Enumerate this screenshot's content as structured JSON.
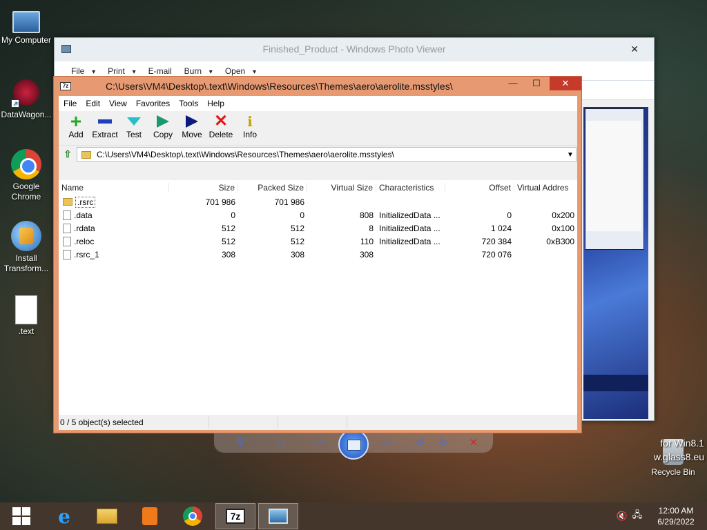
{
  "desktop": {
    "icons": [
      {
        "label": "My Computer"
      },
      {
        "label": "DataWagon..."
      },
      {
        "label": "Google Chrome"
      },
      {
        "label": "Install Transform..."
      },
      {
        "label": ".text"
      },
      {
        "label": "Recycle Bin"
      }
    ],
    "watermark_line1": "for Win8.1",
    "watermark_line2": "w.glass8.eu"
  },
  "photo_viewer": {
    "title": "Finished_Product - Windows Photo Viewer",
    "menu": [
      "File",
      "Print",
      "E-mail",
      "Burn",
      "Open"
    ],
    "help": "?"
  },
  "zip_window": {
    "title": "C:\\Users\\VM4\\Desktop\\.text\\Windows\\Resources\\Themes\\aero\\aerolite.msstyles\\",
    "icon_text": "7z",
    "menu": [
      "File",
      "Edit",
      "View",
      "Favorites",
      "Tools",
      "Help"
    ],
    "toolbar": [
      "Add",
      "Extract",
      "Test",
      "Copy",
      "Move",
      "Delete",
      "Info"
    ],
    "address": "C:\\Users\\VM4\\Desktop\\.text\\Windows\\Resources\\Themes\\aero\\aerolite.msstyles\\",
    "columns": [
      "Name",
      "Size",
      "Packed Size",
      "Virtual Size",
      "Characteristics",
      "Offset",
      "Virtual Addres"
    ],
    "rows": [
      {
        "name": ".rsrc",
        "size": "701 986",
        "packed": "701 986",
        "virtual": "",
        "char": "",
        "offset": "",
        "vaddr": ""
      },
      {
        "name": ".data",
        "size": "0",
        "packed": "0",
        "virtual": "808",
        "char": "InitializedData ...",
        "offset": "0",
        "vaddr": "0x200"
      },
      {
        "name": ".rdata",
        "size": "512",
        "packed": "512",
        "virtual": "8",
        "char": "InitializedData ...",
        "offset": "1 024",
        "vaddr": "0x100"
      },
      {
        "name": ".reloc",
        "size": "512",
        "packed": "512",
        "virtual": "110",
        "char": "InitializedData ...",
        "offset": "720 384",
        "vaddr": "0xB300"
      },
      {
        "name": ".rsrc_1",
        "size": "308",
        "packed": "308",
        "virtual": "308",
        "char": "",
        "offset": "720 076",
        "vaddr": ""
      }
    ],
    "status": "0 / 5 object(s) selected"
  },
  "taskbar": {
    "sevenzip_label": "7z",
    "time": "12:00 AM",
    "date": "6/29/2022"
  }
}
